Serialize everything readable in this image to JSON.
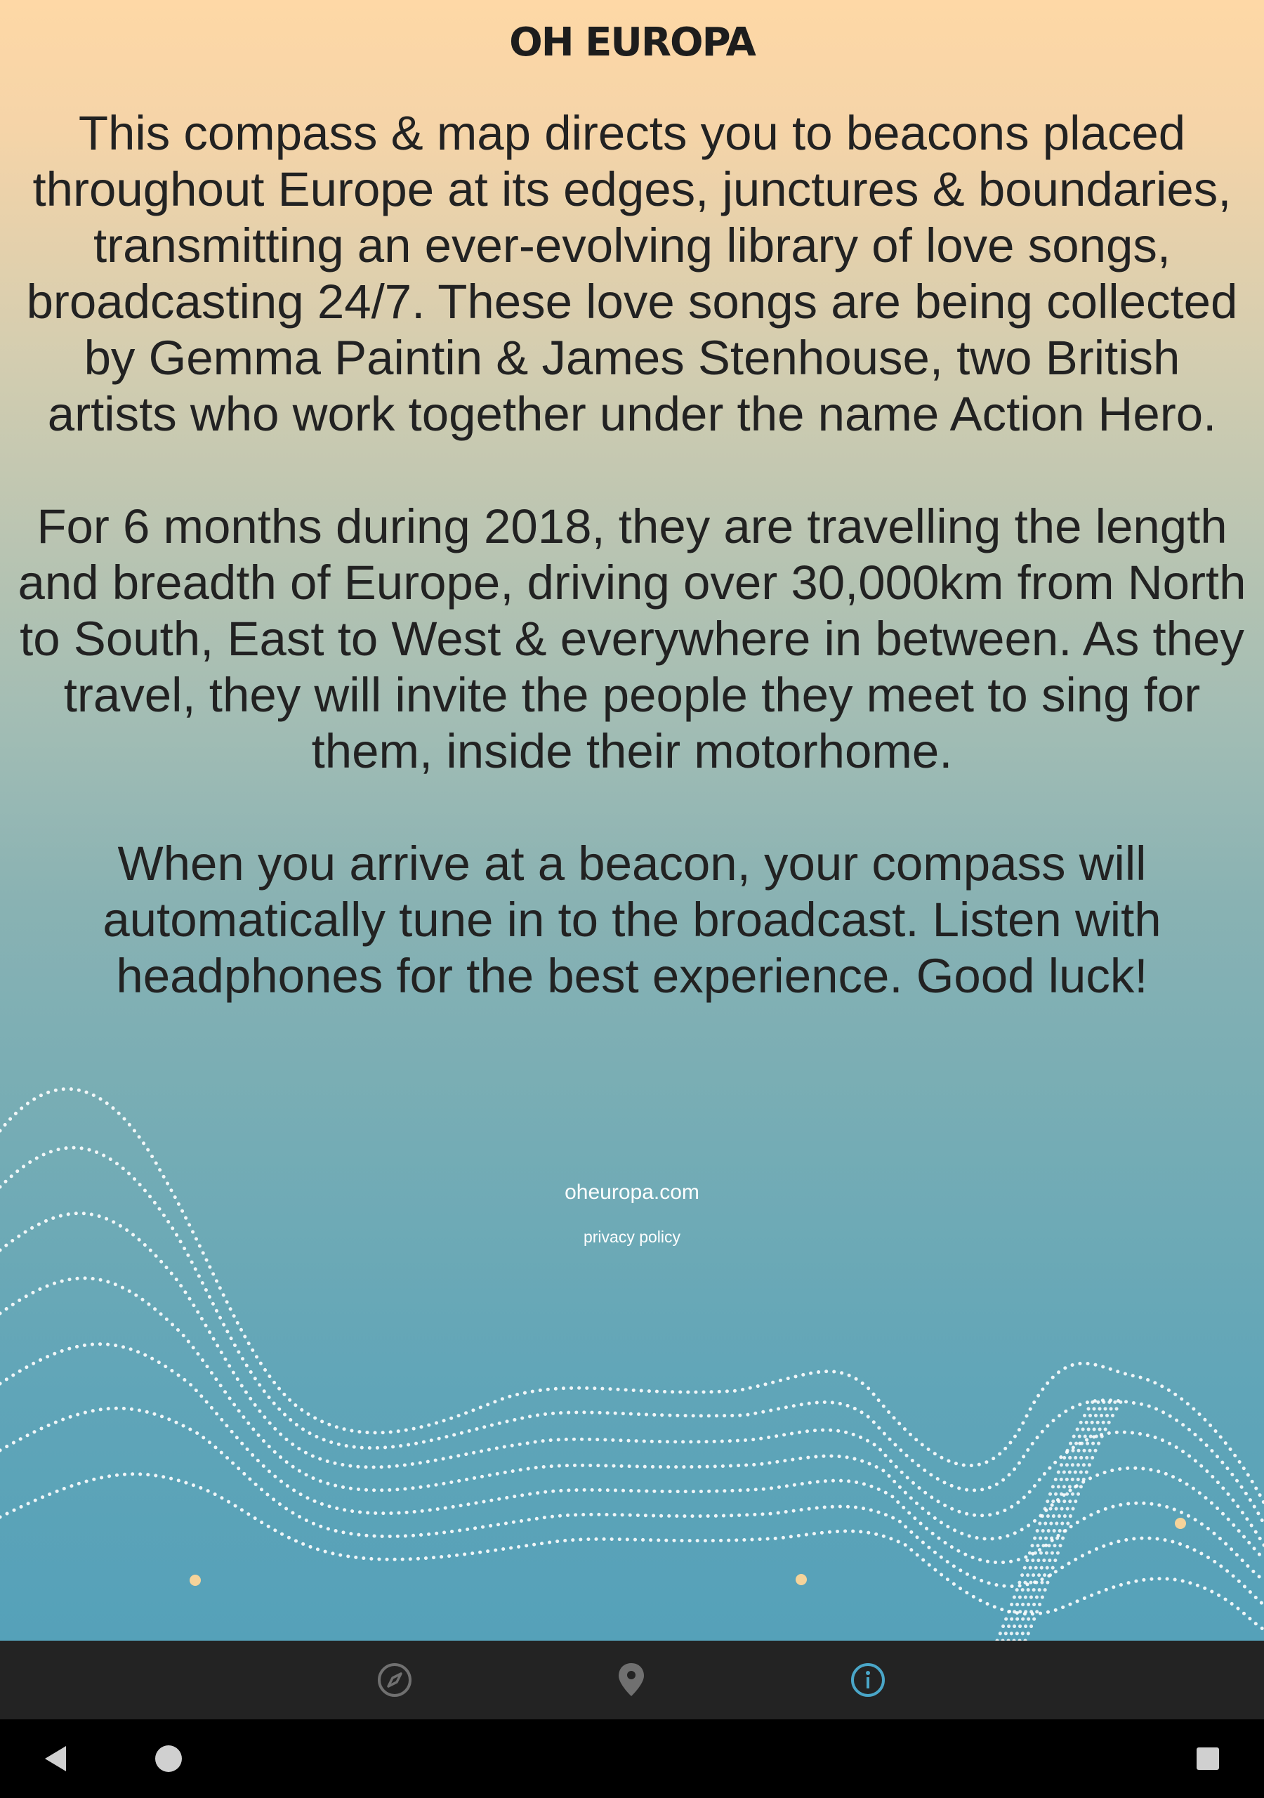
{
  "app": {
    "title": "OH EUROPA"
  },
  "about": {
    "paragraphs": [
      "This compass & map directs you to beacons placed throughout Europe at its edges, junctures & boundaries, transmitting an ever-evolving library of love songs, broadcasting 24/7. These love songs are being collected by Gemma Paintin & James Stenhouse, two British artists who work together under the name Action Hero.",
      "For 6 months during 2018, they are travelling the length and breadth of Europe, driving over 30,000km from North to South, East to West & everywhere in between. As they travel, they will invite the people they meet to sing for them, inside their motorhome.",
      "When you arrive at a beacon, your compass will automatically tune in to the broadcast. Listen with headphones for the best experience. Good luck!"
    ],
    "website": "oheuropa.com",
    "privacy": "privacy policy"
  },
  "tabs": [
    {
      "name": "compass",
      "icon": "compass-icon",
      "active": false
    },
    {
      "name": "map",
      "icon": "map-pin-icon",
      "active": false
    },
    {
      "name": "info",
      "icon": "info-icon",
      "active": true
    }
  ],
  "system_nav": [
    "back-icon",
    "home-icon",
    "recents-icon"
  ],
  "colors": {
    "gradient_top": "#fed8a6",
    "gradient_bottom": "#55a1b9",
    "tab_active": "#4aa6c8",
    "tab_inactive": "#707070",
    "tabbar_bg": "#232323",
    "beacon_dot": "#f5d39a"
  }
}
